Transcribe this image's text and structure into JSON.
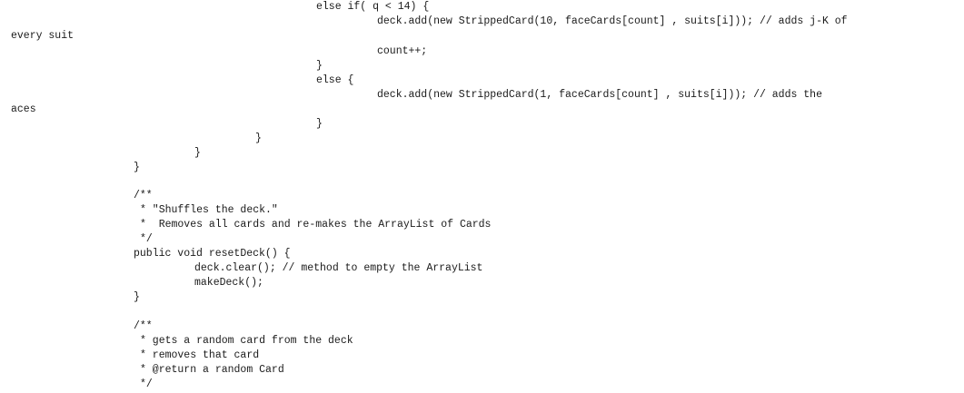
{
  "document": {
    "lines": [
      "else if( q < 14) {",
      "deck.add(new StrippedCard(10, faceCards[count] , suits[i])); // adds j-K of",
      "every suit",
      "count++;",
      "}",
      "else {",
      "deck.add(new StrippedCard(1, faceCards[count] , suits[i])); // adds the",
      "aces",
      "}",
      "}",
      "}",
      "}",
      "/**",
      "* \"Shuffles the deck.\"",
      "*  Removes all cards and re-makes the ArrayList of Cards",
      "*/",
      "public void resetDeck() {",
      "deck.clear(); // method to empty the ArrayList",
      "makeDeck();",
      "}",
      "/**",
      "* gets a random card from the deck",
      "* removes that card",
      "* @return a random Card",
      "*/"
    ]
  }
}
